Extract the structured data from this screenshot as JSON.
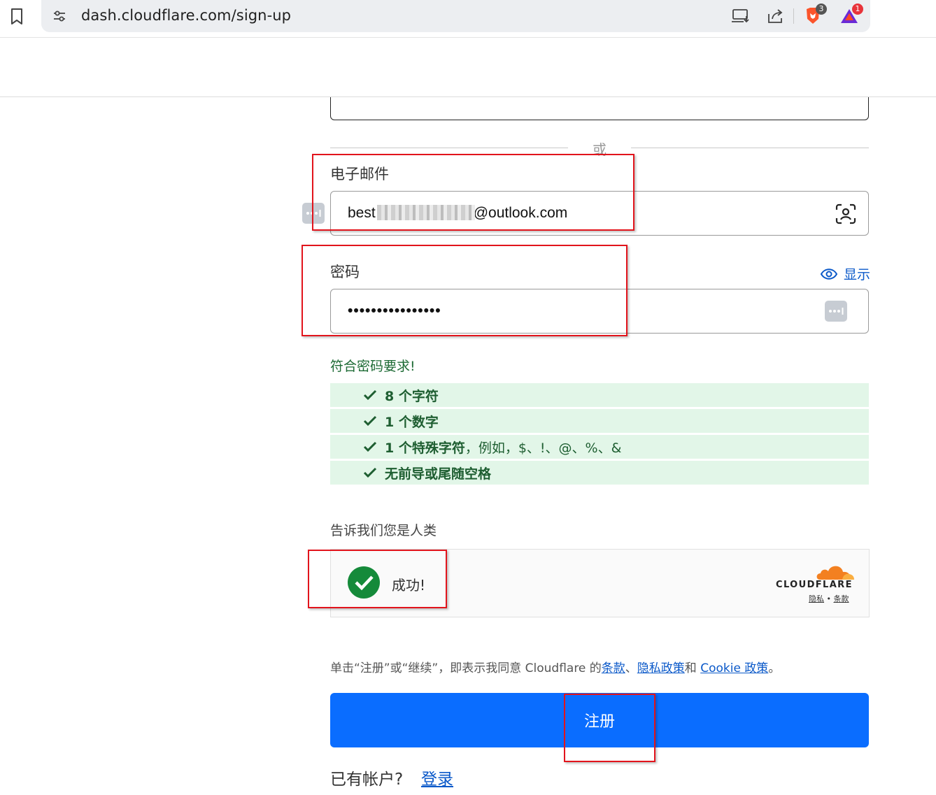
{
  "browser": {
    "url": "dash.cloudflare.com/sign-up",
    "shields_badge": "3",
    "rewards_badge": "1"
  },
  "form": {
    "divider_text": "或",
    "email_label": "电子邮件",
    "email_value_prefix": "best",
    "email_value_suffix": "@outlook.com",
    "password_label": "密码",
    "password_value": "••••••••••••••••",
    "show_label": "显示",
    "requirements_title": "符合密码要求!",
    "requirements": [
      {
        "bold": "8 个字符",
        "rest": ""
      },
      {
        "bold": "1 个数字",
        "rest": ""
      },
      {
        "bold": "1 个特殊字符",
        "rest": "，例如，$、!、@、%、&"
      },
      {
        "bold": "无前导或尾随空格",
        "rest": ""
      }
    ],
    "human_label": "告诉我们您是人类",
    "turnstile_status": "成功!",
    "turnstile_brand": "CLOUDFLARE",
    "turnstile_privacy": "隐私",
    "turnstile_dot": " • ",
    "turnstile_terms": "条款",
    "terms_prefix": "单击“注册”或“继续”，即表示我同意 Cloudflare 的",
    "terms_link": "条款",
    "terms_sep1": "、",
    "privacy_link": "隐私政策",
    "terms_sep2": "和 ",
    "cookie_link": "Cookie 政策",
    "terms_end": "。",
    "signup_button": "注册",
    "have_account": "已有帐户?",
    "login_link": "登录"
  },
  "colors": {
    "primary_button": "#0a6dff",
    "link": "#0b59c9",
    "success_green": "#158a3a",
    "requirement_bg": "#e2f6e8",
    "annotation_red": "#e2141c"
  }
}
